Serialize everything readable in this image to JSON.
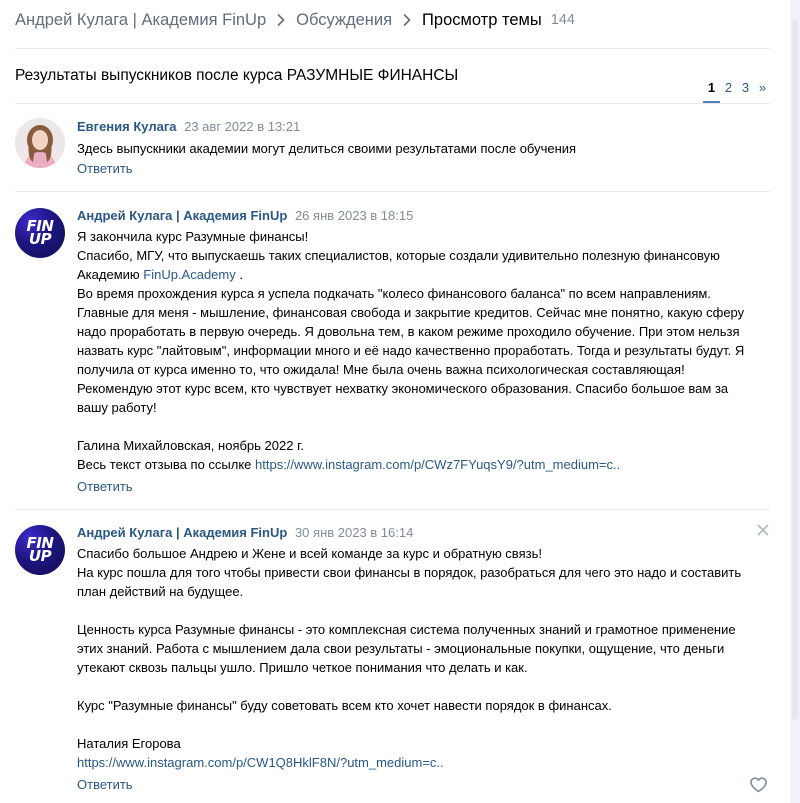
{
  "breadcrumb": {
    "items": [
      "Андрей Кулага | Академия FinUp",
      "Обсуждения"
    ],
    "current": "Просмотр темы",
    "count": "144"
  },
  "topic": {
    "title": "Результаты выпускников после курса РАЗУМНЫЕ ФИНАНСЫ"
  },
  "pager": {
    "pages": [
      "1",
      "2",
      "3",
      "»"
    ],
    "active": "1"
  },
  "posts": [
    {
      "author": "Евгения Кулага",
      "date": "23 авг 2022 в 13:21",
      "text": "Здесь выпускники академии могут делиться своими результатами после обучения",
      "reply": "Ответить"
    },
    {
      "author": "Андрей Кулага | Академия FinUp",
      "date": "26 янв 2023 в 18:15",
      "logo": "FIN UP",
      "text_lines": [
        "Я закончила курс Разумные финансы!",
        "Спасибо, МГУ, что выпускаешь таких специалистов, которые создали удивительно полезную финансовую",
        "Академию ",
        "FinUp.Academy",
        " .",
        "Во время прохождения курса я успела подкачать \"колесо финансового баланса\" по всем направлениям.",
        "Главные для меня - мышление, финансовая свобода и закрытие кредитов. Сейчас мне понятно, какую сферу",
        "надо проработать в первую очередь. Я довольна тем, в каком режиме проходило обучение. При этом нельзя",
        "назвать курс \"лайтовым\", информации много и её надо качественно проработать. Тогда и результаты будут. Я",
        "получила от курса именно то, что ожидала! Мне была очень важна психологическая составляющая!",
        "Рекомендую этот курс всем, кто чувствует нехватку экономического образования. Спасибо большое вам за",
        "вашу работу!",
        "Галина Михайловская, ноябрь 2022 г.",
        "Весь текст отзыва по ссылке ",
        "https://www.instagram.com/p/CWz7FYuqsY9/?utm_medium=c.."
      ],
      "reply": "Ответить"
    },
    {
      "author": "Андрей Кулага | Академия FinUp",
      "date": "30 янв 2023 в 16:14",
      "logo": "FIN UP",
      "text_lines": [
        "Спасибо большое Андрею и Жене и всей команде за курс и обратную связь!",
        "На курс пошла для того чтобы привести свои финансы в порядок, разобраться для чего это надо и составить",
        "план действий на будущее.",
        "Ценность курса Разумные финансы - это комплексная система полученных знаний и грамотное применение",
        "этих знаний. Работа с мышлением дала свои результаты - эмоциональные покупки, ощущение, что деньги",
        "утекают сквозь пальцы ушло. Пришло четкое понимания что делать и как.",
        "Курс \"Разумные финансы\" буду советовать всем кто хочет навести порядок в финансах.",
        "Наталия Егорова",
        "https://www.instagram.com/p/CW1Q8HklF8N/?utm_medium=c.."
      ],
      "reply": "Ответить"
    }
  ],
  "icons": {
    "breadcrumb_separator": "chevron-right-icon",
    "delete": "close-icon",
    "like": "heart-icon"
  },
  "colors": {
    "link": "#2a5885",
    "muted": "#818c99",
    "accent": "#5181b8",
    "avatar_brand": "#1d1580"
  }
}
